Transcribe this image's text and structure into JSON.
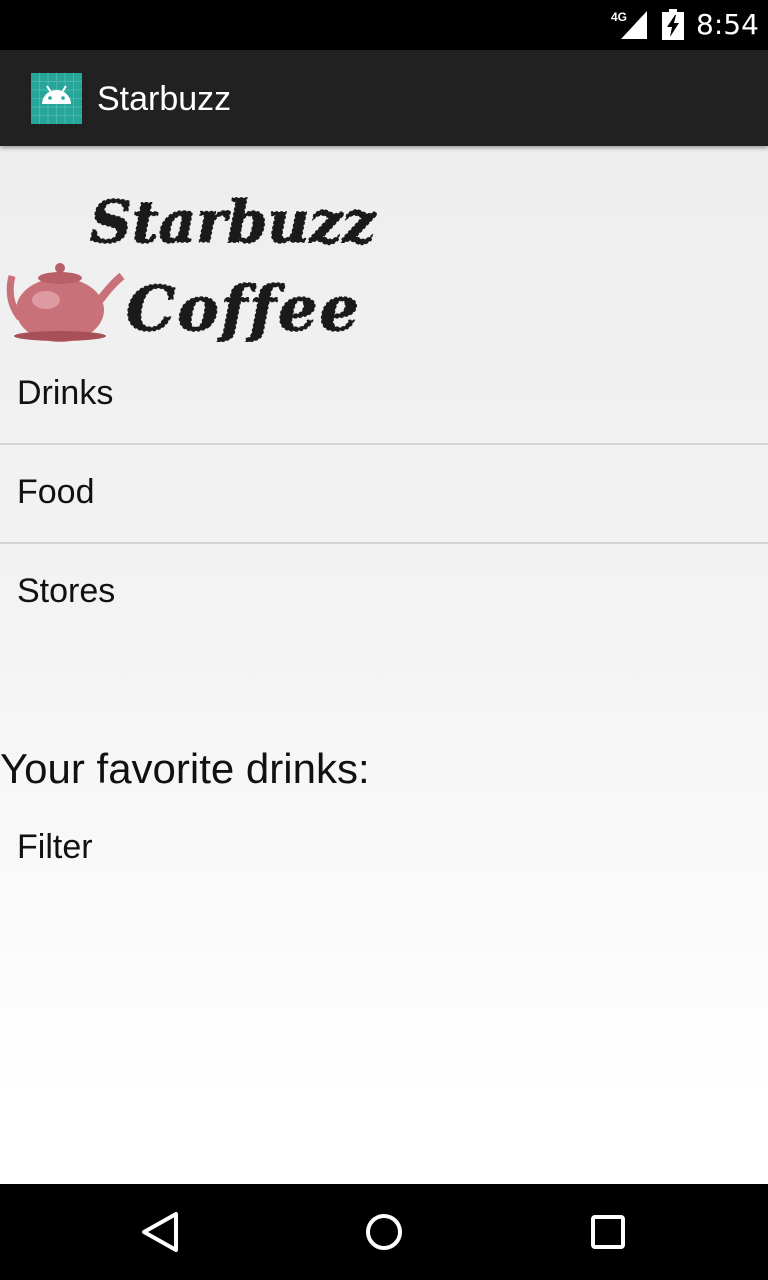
{
  "status_bar": {
    "network_label": "4G",
    "time": "8:54",
    "icons": [
      "cellular-signal-icon",
      "battery-charging-icon"
    ]
  },
  "action_bar": {
    "title": "Starbuzz",
    "icon": "android-app-icon",
    "icon_color": "#26a69a"
  },
  "logo": {
    "line1": "Starbuzz",
    "line2": "Coffee",
    "teapot_color": "#c97178"
  },
  "nav_options": [
    {
      "label": "Drinks"
    },
    {
      "label": "Food"
    },
    {
      "label": "Stores"
    }
  ],
  "favorites": {
    "heading": "Your favorite drinks:",
    "items": [
      {
        "label": "Filter"
      }
    ]
  },
  "navigation_bar": {
    "buttons": [
      "back-icon",
      "home-icon",
      "recents-icon"
    ]
  }
}
